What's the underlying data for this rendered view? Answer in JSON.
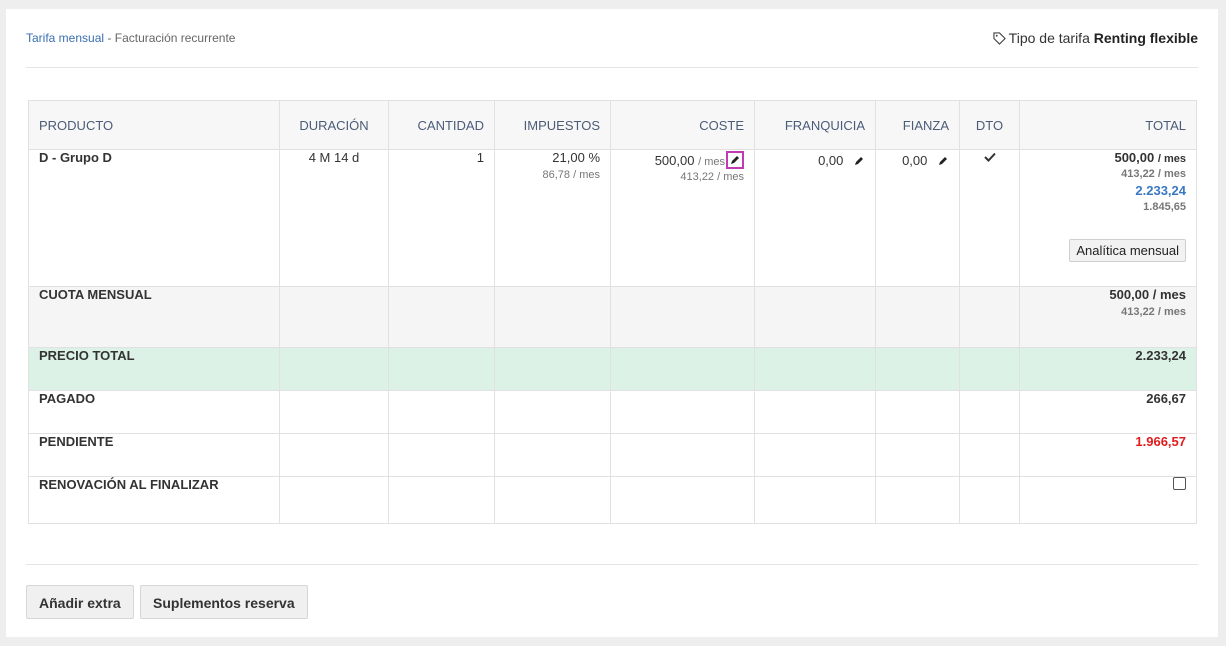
{
  "breadcrumb": {
    "link": "Tarifa mensual",
    "separator": "-",
    "current": "Facturación recurrente"
  },
  "tariff": {
    "label": "Tipo de tarifa",
    "value": "Renting flexible"
  },
  "columns": [
    "PRODUCTO",
    "DURACIÓN",
    "CANTIDAD",
    "IMPUESTOS",
    "COSTE",
    "FRANQUICIA",
    "FIANZA",
    "DTO",
    "TOTAL"
  ],
  "product": {
    "name": "D - Grupo D",
    "duration": "4 M 14 d",
    "quantity": "1",
    "tax_rate": "21,00 %",
    "tax_amount": "86,78",
    "tax_unit": "/ mes",
    "cost": "500,00",
    "cost_unit": "/ mes",
    "cost_net": "413,22 / mes",
    "franchise": "0,00",
    "deposit": "0,00",
    "discount_icon": "check-icon",
    "total_monthly": "500,00",
    "total_monthly_unit": "/ mes",
    "total_monthly_net": "413,22 / mes",
    "total_amount": "2.233,24",
    "total_amount_net": "1.845,65",
    "analytics_button": "Analítica mensual"
  },
  "summary": {
    "cuota_label": "CUOTA MENSUAL",
    "cuota_value": "500,00 / mes",
    "cuota_net": "413,22 / mes",
    "precio_label": "PRECIO TOTAL",
    "precio_value": "2.233,24",
    "pagado_label": "PAGADO",
    "pagado_value": "266,67",
    "pendiente_label": "PENDIENTE",
    "pendiente_value": "1.966,57",
    "renovacion_label": "RENOVACIÓN AL FINALIZAR"
  },
  "buttons": {
    "add_extra": "Añadir extra",
    "supplements": "Suplementos reserva"
  },
  "colors": {
    "link": "#3a6fb0",
    "highlight_row": "#dcf2e7",
    "pending": "#e11b1b",
    "focus_border": "#c03ab8"
  }
}
